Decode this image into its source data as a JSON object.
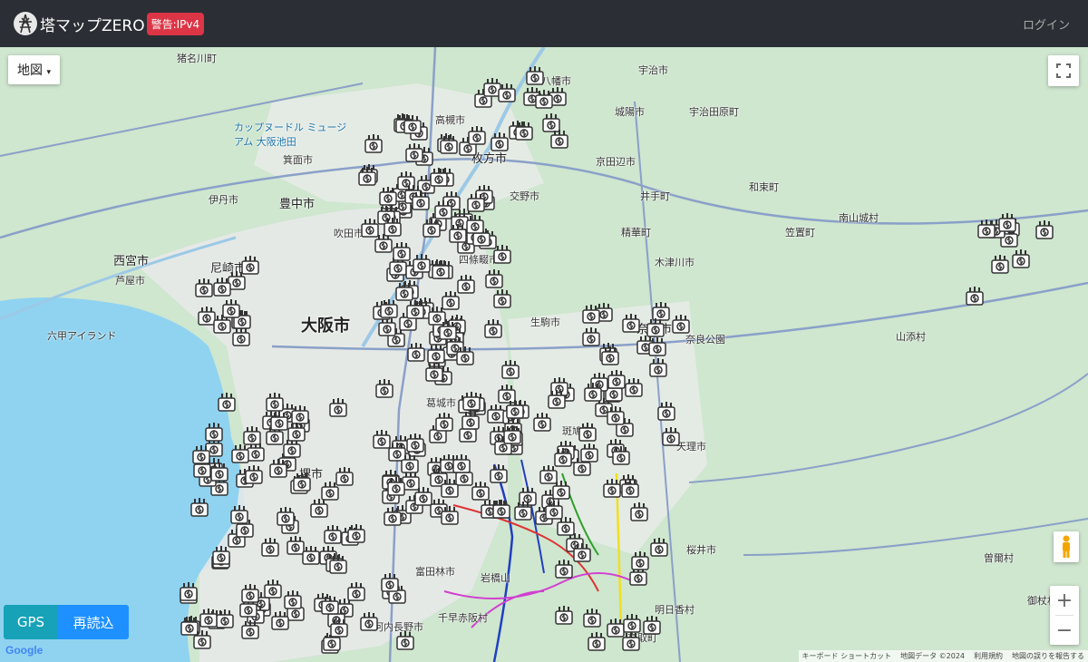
{
  "header": {
    "title": "塔マップZERO",
    "warning_badge": "警告:IPv4",
    "login": "ログイン"
  },
  "map": {
    "type_button": "地図",
    "gps_button": "GPS",
    "reload_button": "再読込",
    "google_logo": "Google",
    "attribution": [
      "キーボード ショートカット",
      "地図データ ©2024",
      "利用規約",
      "地図の誤りを報告する"
    ],
    "labels": [
      {
        "text": "大阪市",
        "size": "big"
      },
      {
        "text": "枚方市",
        "size": "mid"
      },
      {
        "text": "豊中市",
        "size": "mid"
      },
      {
        "text": "西宮市",
        "size": "mid"
      },
      {
        "text": "尼崎市",
        "size": "mid"
      },
      {
        "text": "奈良市",
        "size": "mid"
      },
      {
        "text": "堺市",
        "size": "mid"
      },
      {
        "text": "宇治市",
        "size": "small"
      },
      {
        "text": "宇治田原町",
        "size": "small"
      },
      {
        "text": "城陽市",
        "size": "small"
      },
      {
        "text": "八幡市",
        "size": "small"
      },
      {
        "text": "高槻市",
        "size": "small"
      },
      {
        "text": "箕面市",
        "size": "small"
      },
      {
        "text": "伊丹市",
        "size": "small"
      },
      {
        "text": "吹田市",
        "size": "small"
      },
      {
        "text": "交野市",
        "size": "small"
      },
      {
        "text": "京田辺市",
        "size": "small"
      },
      {
        "text": "井手町",
        "size": "small"
      },
      {
        "text": "精華町",
        "size": "small"
      },
      {
        "text": "和束町",
        "size": "small"
      },
      {
        "text": "笠置町",
        "size": "small"
      },
      {
        "text": "南山城村",
        "size": "small"
      },
      {
        "text": "木津川市",
        "size": "small"
      },
      {
        "text": "四條畷市",
        "size": "small"
      },
      {
        "text": "生駒市",
        "size": "small"
      },
      {
        "text": "芦屋市",
        "size": "small"
      },
      {
        "text": "六甲アイランド",
        "size": "small"
      },
      {
        "text": "猪名川町",
        "size": "small"
      },
      {
        "text": "天理市",
        "size": "small"
      },
      {
        "text": "斑鳩町",
        "size": "small"
      },
      {
        "text": "桜井市",
        "size": "small"
      },
      {
        "text": "明日香村",
        "size": "small"
      },
      {
        "text": "高取町",
        "size": "small"
      },
      {
        "text": "曽爾村",
        "size": "small"
      },
      {
        "text": "御杖村",
        "size": "small"
      },
      {
        "text": "山添村",
        "size": "small"
      },
      {
        "text": "富田林市",
        "size": "small"
      },
      {
        "text": "河内長野市",
        "size": "small"
      },
      {
        "text": "千早赤阪村",
        "size": "small"
      },
      {
        "text": "岩橋山",
        "size": "small"
      },
      {
        "text": "カップヌードル ミュージアム 大阪池田",
        "size": "blue"
      },
      {
        "text": "奈良公園",
        "size": "small"
      },
      {
        "text": "葛城市",
        "size": "small"
      }
    ]
  }
}
